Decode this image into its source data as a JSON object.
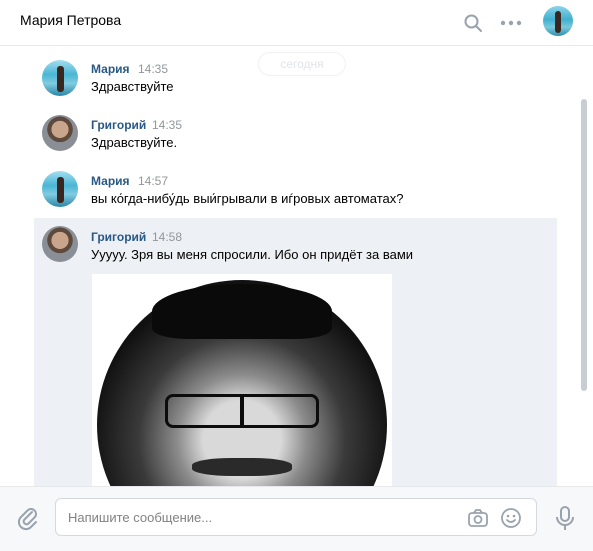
{
  "header": {
    "title": "Мария Петрова",
    "icons": [
      "search-icon",
      "more-icon",
      "avatar"
    ]
  },
  "chat": {
    "date_badge": "сегодня",
    "messages": [
      {
        "author": "Мария",
        "time": "14:35",
        "text": "Здравствуйте",
        "avatar": "maria"
      },
      {
        "author": "Григорий",
        "time": "14:35",
        "text": "Здравствуйте.",
        "avatar": "grigoriy"
      },
      {
        "author": "Мария",
        "time": "14:57",
        "text": "вы ко́гда-нибу́дь выи́грывали в иѓровых автоматах?",
        "avatar": "maria"
      },
      {
        "author": "Григорий",
        "time": "14:58",
        "text": "Ууууу. Зря вы меня спросили. Ибо он придёт за вами",
        "avatar": "grigoriy",
        "has_photo": true
      }
    ]
  },
  "composer": {
    "placeholder": "Напишите сообщение...",
    "icons": [
      "attach-icon",
      "camera-icon",
      "smile-icon",
      "microphone-icon"
    ]
  },
  "colors": {
    "author_name": "#2a5885",
    "time": "#939699",
    "highlight_bg": "#edf0f5",
    "footer_bg": "#f7f8fa"
  }
}
